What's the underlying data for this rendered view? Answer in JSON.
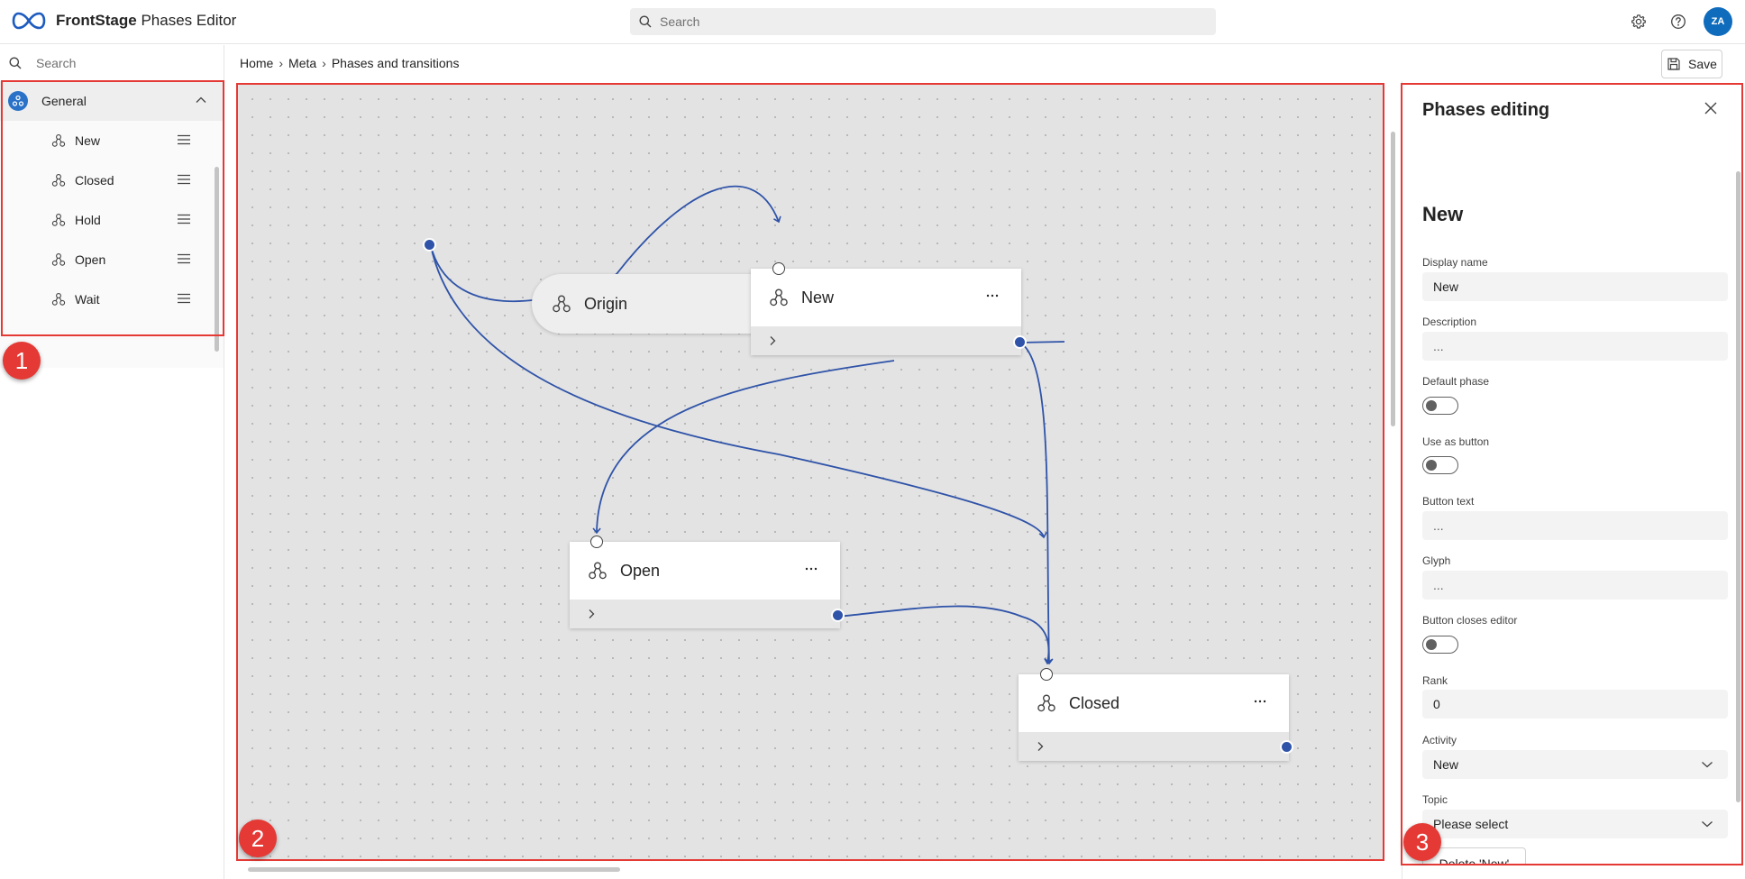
{
  "app": {
    "brand_bold": "FrontStage",
    "brand_rest": "Phases Editor",
    "search_placeholder": "Search",
    "avatar_initials": "ZA"
  },
  "sidebar": {
    "search_placeholder": "Search",
    "group": {
      "label": "General",
      "items": [
        {
          "label": "New"
        },
        {
          "label": "Closed"
        },
        {
          "label": "Hold"
        },
        {
          "label": "Open"
        },
        {
          "label": "Wait"
        }
      ]
    }
  },
  "breadcrumb": [
    "Home",
    "Meta",
    "Phases and transitions"
  ],
  "toolbar": {
    "save_label": "Save"
  },
  "canvas": {
    "origin_label": "Origin",
    "nodes": {
      "new": "New",
      "open": "Open",
      "closed": "Closed"
    }
  },
  "panel": {
    "title": "Phases editing",
    "heading": "New",
    "fields": {
      "display_name_label": "Display name",
      "display_name_value": "New",
      "description_label": "Description",
      "description_value": "...",
      "default_phase_label": "Default phase",
      "use_as_button_label": "Use as button",
      "button_text_label": "Button text",
      "button_text_value": "...",
      "glyph_label": "Glyph",
      "glyph_value": "...",
      "button_closes_editor_label": "Button closes editor",
      "rank_label": "Rank",
      "rank_value": "0",
      "activity_label": "Activity",
      "activity_value": "New",
      "topic_label": "Topic",
      "topic_value": "Please select"
    },
    "toggles": {
      "default_phase": false,
      "use_as_button": false,
      "button_closes_editor": false
    },
    "delete_label": "Delete 'New'"
  },
  "annotations": [
    "1",
    "2",
    "3"
  ],
  "colors": {
    "accent": "#0f6cbd",
    "edge": "#2f53a8",
    "highlight": "#e53935"
  }
}
